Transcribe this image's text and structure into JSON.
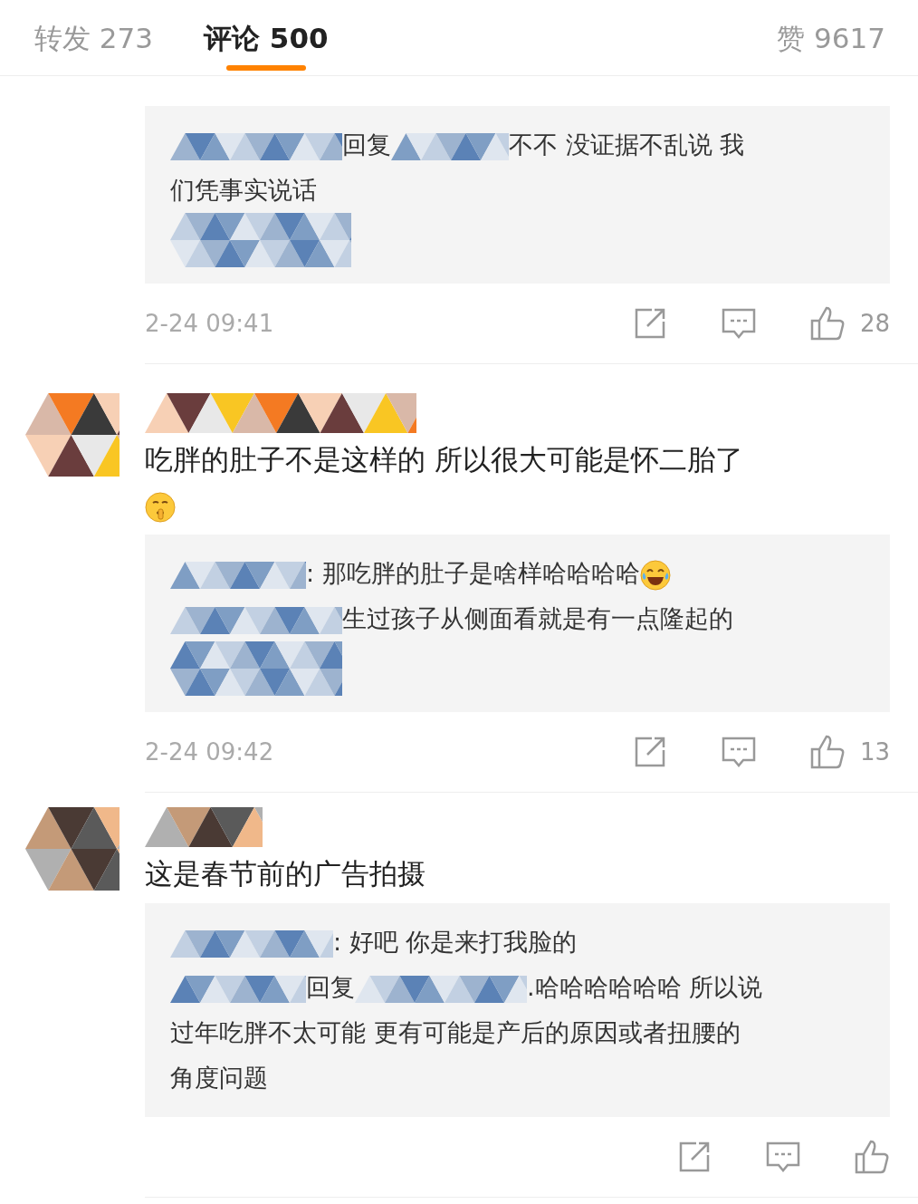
{
  "tabs": [
    {
      "label": "转发 273",
      "selected": false
    },
    {
      "label": "评论 500",
      "selected": true
    },
    {
      "label": "赞 9617",
      "selected": false
    }
  ],
  "comments": [
    {
      "reply": [
        {
          "kind": "redacted"
        },
        {
          "kind": "text",
          "text": "回复"
        },
        {
          "kind": "redacted"
        },
        {
          "kind": "text",
          "text": "不不 没证据不乱说 我"
        },
        {
          "kind": "break"
        },
        {
          "kind": "text",
          "text": "们凭事实说话"
        },
        {
          "kind": "break"
        },
        {
          "kind": "redacted"
        }
      ],
      "time": "2-24 09:41",
      "likes": "28"
    },
    {
      "author_redacted": true,
      "text_parts": [
        {
          "kind": "text",
          "text": "吃胖的肚子不是这样的 所以很大可能是怀二胎了"
        },
        {
          "kind": "break"
        },
        {
          "kind": "emoji-shush"
        }
      ],
      "reply": [
        {
          "kind": "redacted"
        },
        {
          "kind": "text",
          "text": ": 那吃胖的肚子是啥样哈哈哈哈"
        },
        {
          "kind": "emoji-laugh"
        },
        {
          "kind": "break"
        },
        {
          "kind": "redacted"
        },
        {
          "kind": "text",
          "text": "生过孩子从侧面看就是有一点隆起的"
        },
        {
          "kind": "break"
        },
        {
          "kind": "redacted"
        }
      ],
      "time": "2-24 09:42",
      "likes": "13"
    },
    {
      "author_redacted": true,
      "text_parts": [
        {
          "kind": "text",
          "text": "这是春节前的广告拍摄"
        }
      ],
      "reply": [
        {
          "kind": "redacted"
        },
        {
          "kind": "text",
          "text": ": 好吧 你是来打我脸的"
        },
        {
          "kind": "break"
        },
        {
          "kind": "redacted"
        },
        {
          "kind": "text",
          "text": "回复"
        },
        {
          "kind": "redacted"
        },
        {
          "kind": "text",
          "text": ".哈哈哈哈哈哈 所以说"
        },
        {
          "kind": "break"
        },
        {
          "kind": "text",
          "text": "过年吃胖不太可能 更有可能是产后的原因或者扭腰的"
        },
        {
          "kind": "break"
        },
        {
          "kind": "text",
          "text": "角度问题"
        }
      ]
    }
  ]
}
